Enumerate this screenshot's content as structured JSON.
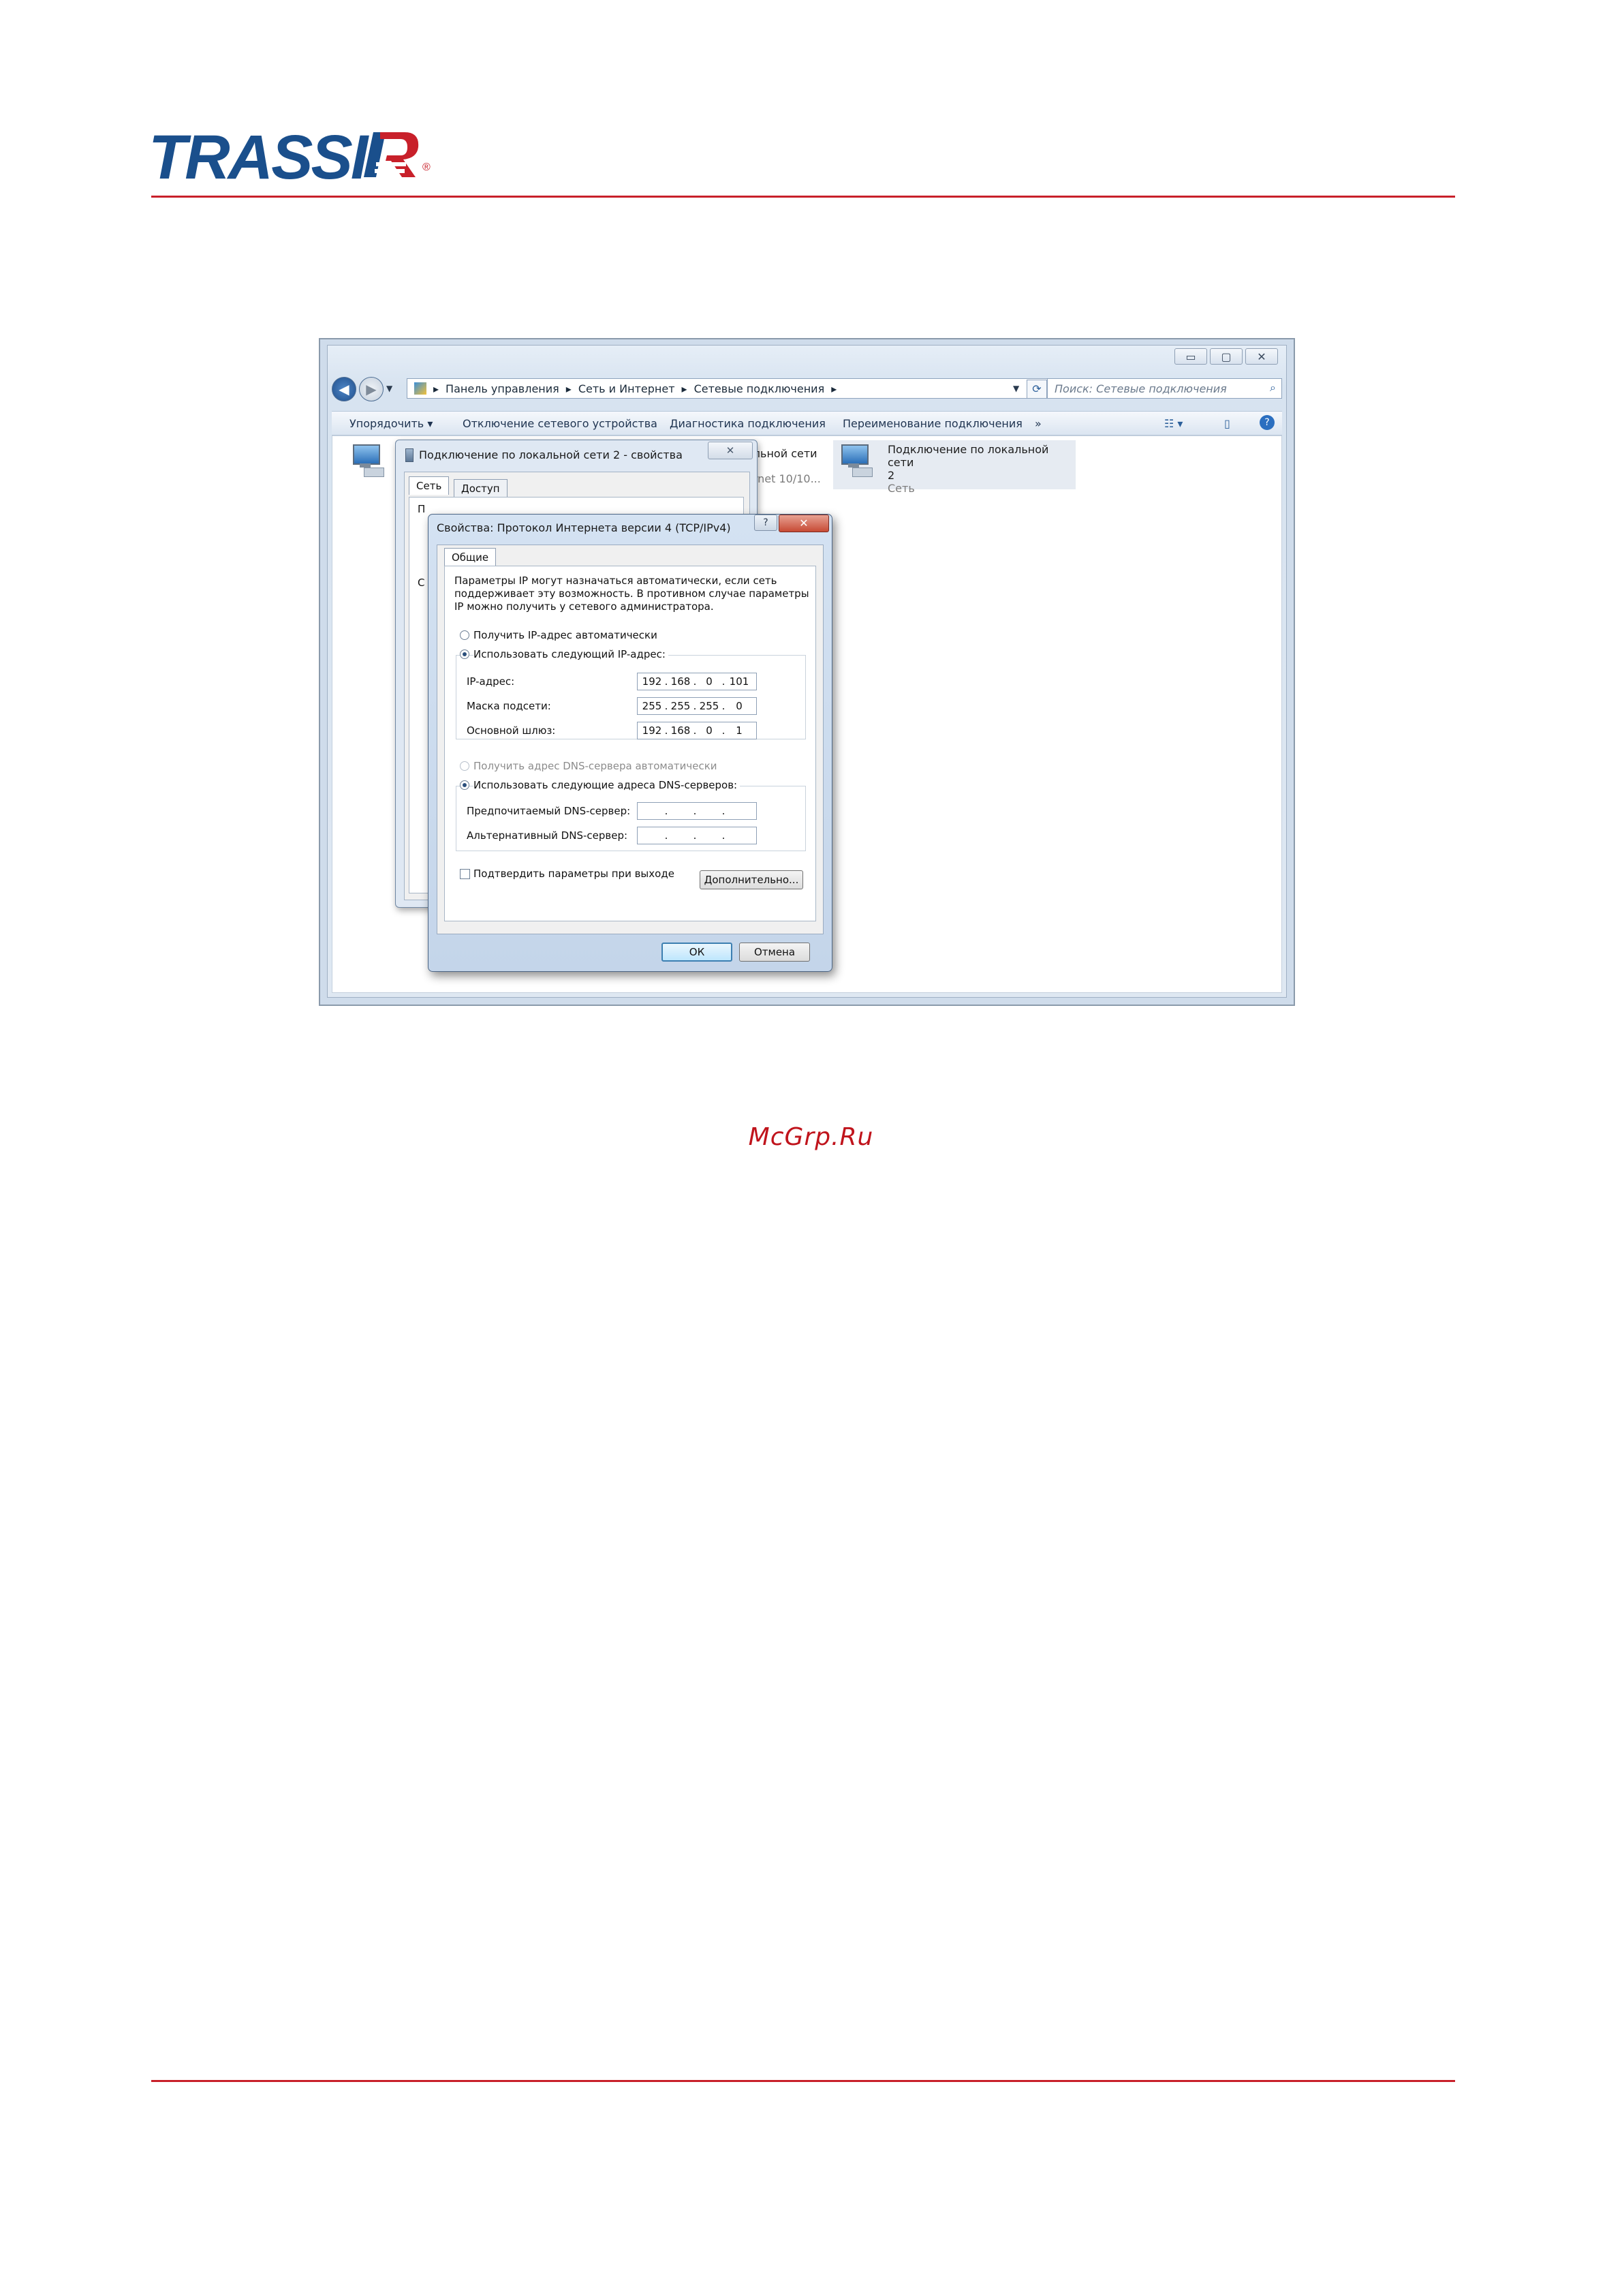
{
  "brand": {
    "logo_text": "TRASSIR",
    "colors": {
      "accent": "#c8202a",
      "logo_blue": "#1a4f8c"
    }
  },
  "watermark": "McGrp.Ru",
  "explorer": {
    "breadcrumb": [
      "Панель управления",
      "Сеть и Интернет",
      "Сетевые подключения"
    ],
    "search_placeholder": "Поиск: Сетевые подключения",
    "toolbar": {
      "organize": "Упорядочить",
      "disable_device": "Отключение сетевого устройства",
      "diagnose": "Диагностика подключения",
      "rename": "Переименование подключения",
      "more": "»"
    },
    "connections": [
      {
        "name_partial": "альной сети",
        "sub_partial": "ernet 10/10..."
      },
      {
        "name": "Подключение по локальной сети",
        "name_line2": "2",
        "status": "Сеть"
      }
    ]
  },
  "dialog_connection": {
    "title": "Подключение по локальной сети 2 - свойства",
    "tabs": [
      "Сеть",
      "Доступ"
    ],
    "partial_label": "П",
    "partial_label_2": "С"
  },
  "dialog_ipv4": {
    "title": "Свойства: Протокол Интернета версии 4 (TCP/IPv4)",
    "help_glyph": "?",
    "tab": "Общие",
    "intro": [
      "Параметры IP могут назначаться автоматически, если сеть",
      "поддерживает эту возможность. В противном случае параметры",
      "IP можно получить у сетевого администратора."
    ],
    "ip_auto": "Получить IP-адрес автоматически",
    "ip_manual": "Использовать следующий IP-адрес:",
    "ip_label": "IP-адрес:",
    "ip_value": [
      "192",
      "168",
      "0",
      "101"
    ],
    "mask_label": "Маска подсети:",
    "mask_value": [
      "255",
      "255",
      "255",
      "0"
    ],
    "gateway_label": "Основной шлюз:",
    "gateway_value": [
      "192",
      "168",
      "0",
      "1"
    ],
    "dns_auto": "Получить адрес DNS-сервера автоматически",
    "dns_manual": "Использовать следующие адреса DNS-серверов:",
    "dns_pref_label": "Предпочитаемый DNS-сервер:",
    "dns_alt_label": "Альтернативный DNS-сервер:",
    "validate_label": "Подтвердить параметры при выходе",
    "advanced": "Дополнительно...",
    "ok": "ОК",
    "cancel": "Отмена"
  }
}
